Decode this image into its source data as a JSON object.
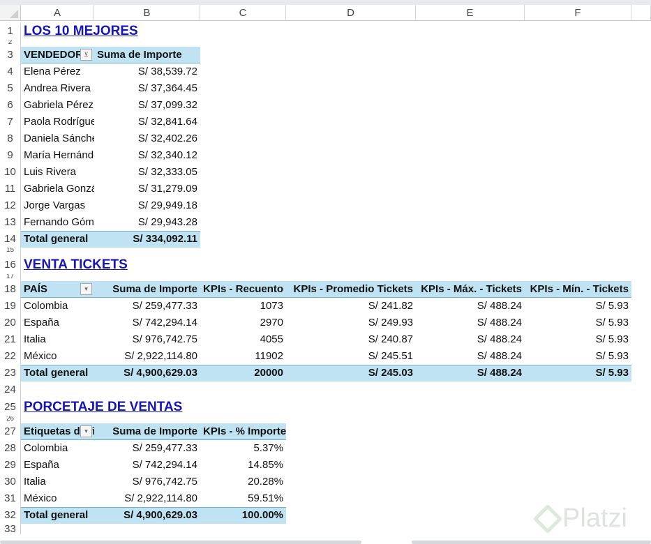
{
  "columns": [
    "A",
    "B",
    "C",
    "D",
    "E",
    "F"
  ],
  "rows": [
    "1",
    "2",
    "3",
    "4",
    "5",
    "6",
    "7",
    "8",
    "9",
    "10",
    "11",
    "12",
    "13",
    "14",
    "15",
    "16",
    "17",
    "18",
    "19",
    "20",
    "21",
    "22",
    "23",
    "24",
    "25",
    "26",
    "27",
    "28",
    "29",
    "30",
    "31",
    "32",
    "33"
  ],
  "top10": {
    "title": "LOS 10 MEJORES",
    "headers": [
      "VENDEDOR",
      "Suma de Importe"
    ],
    "rows": [
      [
        "Elena Pérez",
        "S/ 38,539.72"
      ],
      [
        "Andrea Rivera",
        "S/ 37,364.45"
      ],
      [
        "Gabriela Pérez",
        "S/ 37,099.32"
      ],
      [
        "Paola Rodríguez",
        "S/ 32,841.64"
      ],
      [
        "Daniela Sánchez",
        "S/ 32,402.26"
      ],
      [
        "María Hernández",
        "S/ 32,340.12"
      ],
      [
        "Luis Rivera",
        "S/ 32,333.05"
      ],
      [
        "Gabriela González",
        "S/ 31,279.09"
      ],
      [
        "Jorge Vargas",
        "S/ 29,949.18"
      ],
      [
        "Fernando Gómez",
        "S/ 29,943.28"
      ]
    ],
    "total": [
      "Total general",
      "S/ 334,092.11"
    ]
  },
  "tickets": {
    "title": "VENTA TICKETS",
    "headers": [
      "PAÍS",
      "Suma de Importe",
      "KPIs - Recuento",
      "KPIs - Promedio Tickets",
      "KPIs - Máx. - Tickets",
      "KPIs - Mín. - Tickets"
    ],
    "rows": [
      [
        "Colombia",
        "S/ 259,477.33",
        "1073",
        "S/ 241.82",
        "S/ 488.24",
        "S/ 5.93"
      ],
      [
        "España",
        "S/ 742,294.14",
        "2970",
        "S/ 249.93",
        "S/ 488.24",
        "S/ 5.93"
      ],
      [
        "Italia",
        "S/ 976,742.75",
        "4055",
        "S/ 240.87",
        "S/ 488.24",
        "S/ 5.93"
      ],
      [
        "México",
        "S/ 2,922,114.80",
        "11902",
        "S/ 245.51",
        "S/ 488.24",
        "S/ 5.93"
      ]
    ],
    "total": [
      "Total general",
      "S/ 4,900,629.03",
      "20000",
      "S/ 245.03",
      "S/ 488.24",
      "S/ 5.93"
    ]
  },
  "percent": {
    "title": "PORCETAJE DE VENTAS",
    "headers": [
      "Etiquetas de fila",
      "Suma de Importe",
      "KPIs - % Importe"
    ],
    "rows": [
      [
        "Colombia",
        "S/ 259,477.33",
        "5.37%"
      ],
      [
        "España",
        "S/ 742,294.14",
        "14.85%"
      ],
      [
        "Italia",
        "S/ 976,742.75",
        "20.28%"
      ],
      [
        "México",
        "S/ 2,922,114.80",
        "59.51%"
      ]
    ],
    "total": [
      "Total general",
      "S/ 4,900,629.03",
      "100.00%"
    ]
  },
  "watermark": "Platzi"
}
